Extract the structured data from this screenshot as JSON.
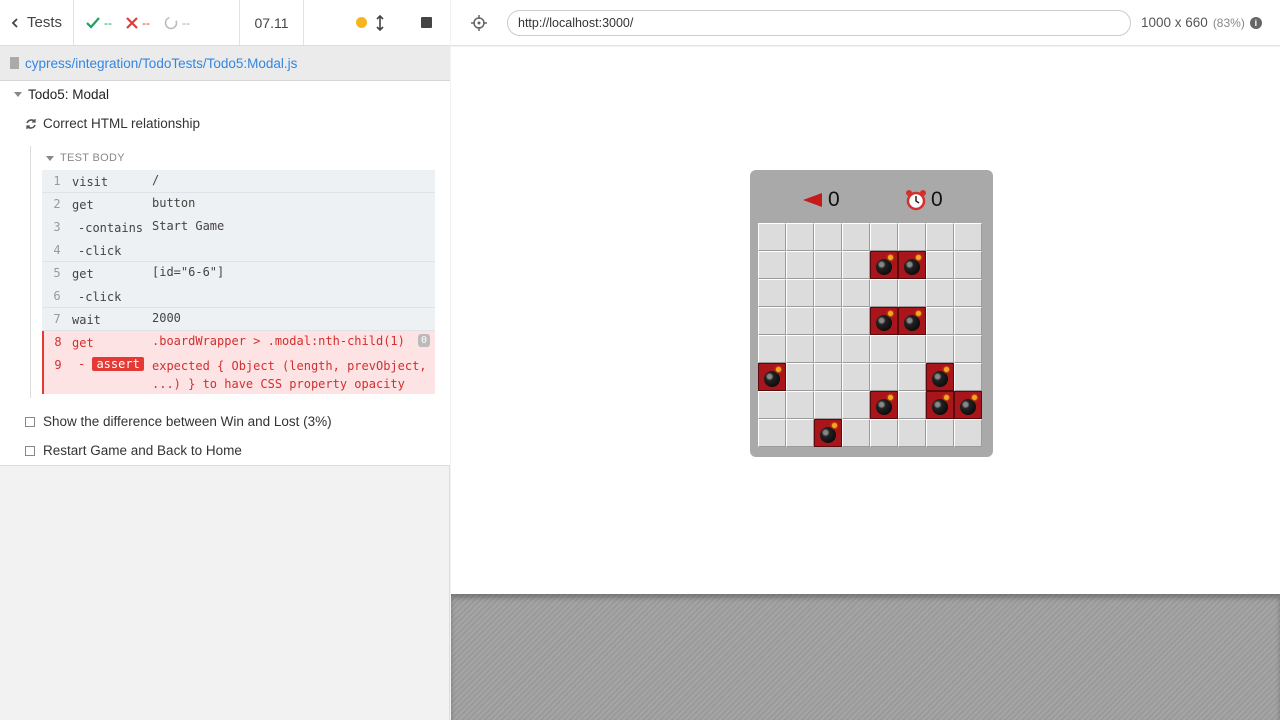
{
  "reporter": {
    "tests_label": "Tests",
    "passed": "--",
    "failed": "--",
    "pending": "--",
    "duration": "07.11",
    "spec_path": "cypress/integration/TodoTests/Todo5:Modal.js",
    "suite_title": "Todo5: Modal",
    "current_test": "Correct HTML relationship",
    "test_body_label": "TEST BODY",
    "commands": [
      {
        "num": "1",
        "name": "visit",
        "msg": "/"
      },
      {
        "num": "2",
        "name": "get",
        "msg": "button"
      },
      {
        "num": "3",
        "name": "-contains",
        "msg": "Start Game"
      },
      {
        "num": "4",
        "name": "-click",
        "msg": ""
      },
      {
        "num": "5",
        "name": "get",
        "msg": "[id=\"6-6\"]"
      },
      {
        "num": "6",
        "name": "-click",
        "msg": ""
      },
      {
        "num": "7",
        "name": "wait",
        "msg": "2000"
      },
      {
        "num": "8",
        "name": "get",
        "msg": ".boardWrapper > .modal:nth-child(1)",
        "badge": "0"
      },
      {
        "num": "9",
        "name": "assert",
        "msg_line1": "expected { Object (length, prevObject,",
        "msg_line2": "...) } to have CSS property opacity"
      }
    ],
    "other_tests": [
      "Show the difference between Win and Lost (3%)",
      "Restart Game and Back to Home"
    ]
  },
  "aut": {
    "url": "http://localhost:3000/",
    "viewport": "1000 x 660",
    "scale": "(83%)",
    "flag_count": "0",
    "timer": "0",
    "bombs": [
      [
        1,
        4
      ],
      [
        1,
        5
      ],
      [
        3,
        4
      ],
      [
        3,
        5
      ],
      [
        5,
        0
      ],
      [
        5,
        6
      ],
      [
        6,
        4
      ],
      [
        6,
        6
      ],
      [
        6,
        7
      ],
      [
        7,
        2
      ]
    ]
  },
  "colors": {
    "pass": "#1aa35a",
    "fail": "#e03b3b",
    "bomb_cell": "#a8151a",
    "link": "#3486e0"
  }
}
